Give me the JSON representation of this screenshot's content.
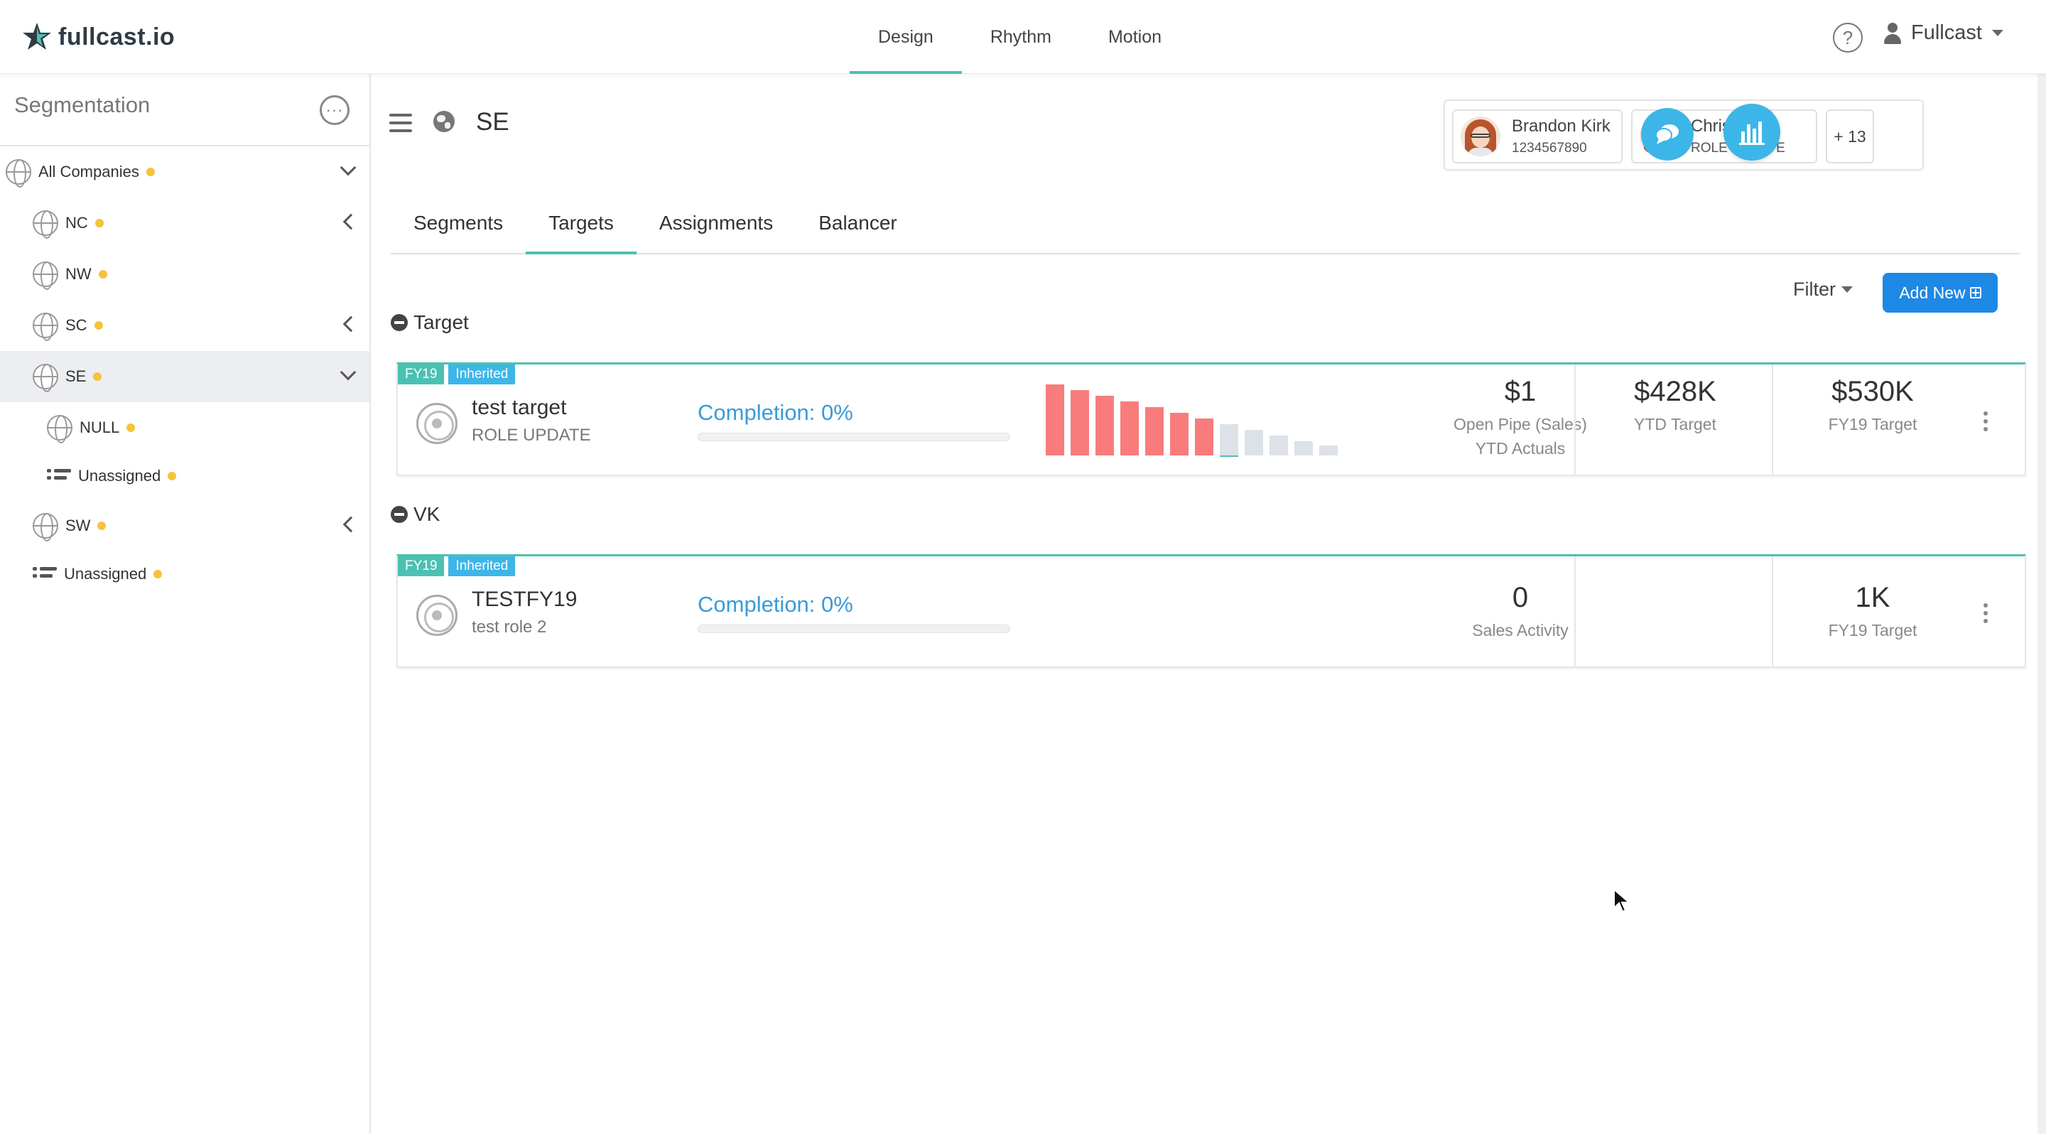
{
  "app": {
    "logo_text": "fullcast.io",
    "brand_color": "#4bc1b2",
    "accent_blue": "#3cb6e8"
  },
  "nav": {
    "items": [
      "Design",
      "Rhythm",
      "Motion"
    ],
    "active": "Design"
  },
  "user_menu": {
    "help": "?",
    "name": "Fullcast"
  },
  "sidebar": {
    "title": "Segmentation",
    "more": "···",
    "items": [
      {
        "label": "All Companies",
        "icon": "globe-icon",
        "chevron": "down"
      },
      {
        "label": "NC",
        "icon": "globe-icon",
        "chevron": "left"
      },
      {
        "label": "NW",
        "icon": "globe-icon",
        "chevron": ""
      },
      {
        "label": "SC",
        "icon": "globe-icon",
        "chevron": "left"
      },
      {
        "label": "SE",
        "icon": "globe-icon",
        "chevron": "down",
        "selected": true
      },
      {
        "label": "NULL",
        "icon": "globe-icon",
        "chevron": ""
      },
      {
        "label": "Unassigned",
        "icon": "list-icon",
        "chevron": ""
      },
      {
        "label": "SW",
        "icon": "globe-icon",
        "chevron": "left"
      },
      {
        "label": "Unassigned",
        "icon": "list-icon",
        "chevron": ""
      }
    ]
  },
  "header": {
    "title": "SE",
    "users": [
      {
        "name": "Brandon Kirk",
        "sub": "1234567890"
      },
      {
        "name": "Chris Arbor",
        "sub": "ROLE UPDATE"
      }
    ],
    "more_users": "+ 13"
  },
  "tabs": {
    "items": [
      "Segments",
      "Targets",
      "Assignments",
      "Balancer"
    ],
    "active": "Targets"
  },
  "toolbar": {
    "filter": "Filter",
    "add_new": "Add New"
  },
  "sections": [
    {
      "title": "Target",
      "card": {
        "badge_fy": "FY19",
        "badge_inherited": "Inherited",
        "name": "test target",
        "sub": "ROLE UPDATE",
        "completion": "Completion: 0%",
        "completion_pct": 0,
        "metric1_value": "$1",
        "metric1_label1": "Open Pipe (Sales)",
        "metric1_label2": "YTD Actuals",
        "metric2_value": "$428K",
        "metric2_label": "YTD Target",
        "metric3_value": "$530K",
        "metric3_label": "FY19 Target",
        "bars": [
          100,
          92,
          84,
          76,
          68,
          60,
          52,
          44,
          36,
          28,
          20,
          14,
          8
        ],
        "bar_colors": [
          "#f87c7c",
          "#f87c7c",
          "#f87c7c",
          "#f87c7c",
          "#f87c7c",
          "#f87c7c",
          "#f87c7c",
          "#dde1e8",
          "#dde1e8",
          "#dde1e8",
          "#dde1e8",
          "#dde1e8",
          "#dde1e8"
        ]
      }
    },
    {
      "title": "VK",
      "card": {
        "badge_fy": "FY19",
        "badge_inherited": "Inherited",
        "name": "TESTFY19",
        "sub": "test role 2",
        "completion": "Completion: 0%",
        "completion_pct": 0,
        "metric1_value": "0",
        "metric1_label1": "Sales Activity",
        "metric3_value": "1K",
        "metric3_label": "FY19 Target"
      }
    }
  ]
}
